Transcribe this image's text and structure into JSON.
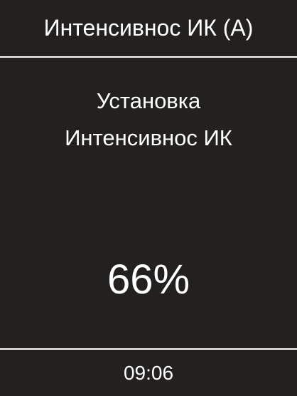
{
  "header": {
    "title": "Интенсивнос ИК (А)"
  },
  "main": {
    "setting_label_line1": "Установка",
    "setting_label_line2": "Интенсивнос ИК",
    "value": "66%"
  },
  "footer": {
    "time": "09:06"
  },
  "colors": {
    "background": "#232120",
    "text": "#ffffff",
    "divider": "#ffffff"
  }
}
